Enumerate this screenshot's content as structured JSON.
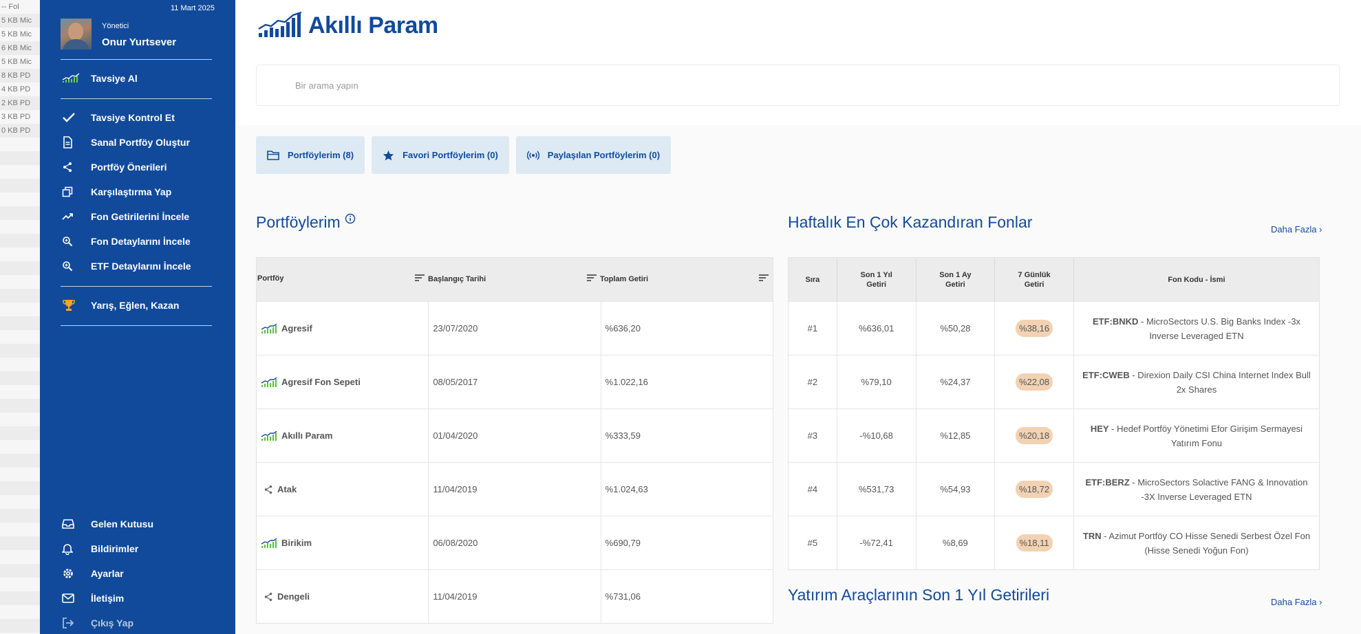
{
  "background_list": [
    {
      "size": "--",
      "type": "Fol"
    },
    {
      "size": "5 KB",
      "type": "Mic"
    },
    {
      "size": "5 KB",
      "type": "Mic"
    },
    {
      "size": "6 KB",
      "type": "Mic"
    },
    {
      "size": "5 KB",
      "type": "Mic"
    },
    {
      "size": "8 KB",
      "type": "PD"
    },
    {
      "size": "4 KB",
      "type": "PD"
    },
    {
      "size": "2 KB",
      "type": "PD"
    },
    {
      "size": "3 KB",
      "type": "PD"
    },
    {
      "size": "0 KB",
      "type": "PD"
    }
  ],
  "sidebar": {
    "date": "11 Mart 2025",
    "role": "Yönetici",
    "user_name": "Onur Yurtsever",
    "top_item": {
      "label": "Tavsiye Al",
      "icon": "chart-icon"
    },
    "items": [
      {
        "label": "Tavsiye Kontrol Et",
        "icon": "check-icon"
      },
      {
        "label": "Sanal Portföy Oluştur",
        "icon": "document-icon"
      },
      {
        "label": "Portföy Önerileri",
        "icon": "share-icon"
      },
      {
        "label": "Karşılaştırma Yap",
        "icon": "compare-icon"
      },
      {
        "label": "Fon Getirilerini İncele",
        "icon": "trend-icon"
      },
      {
        "label": "Fon Detaylarını İncele",
        "icon": "zoom-icon"
      },
      {
        "label": "ETF Detaylarını İncele",
        "icon": "zoom-icon"
      }
    ],
    "game_item": {
      "label": "Yarış, Eğlen, Kazan",
      "icon": "trophy-icon"
    },
    "bottom_items": [
      {
        "label": "Gelen Kutusu",
        "icon": "inbox-icon"
      },
      {
        "label": "Bildirimler",
        "icon": "bell-icon"
      },
      {
        "label": "Ayarlar",
        "icon": "gear-icon"
      },
      {
        "label": "İletişim",
        "icon": "mail-icon"
      },
      {
        "label": "Çıkış Yap",
        "icon": "logout-icon"
      }
    ]
  },
  "header": {
    "logo_text": "Akıllı Param",
    "search_placeholder": "Bir arama yapın"
  },
  "tabs": [
    {
      "label": "Portföylerim (8)",
      "icon": "folder-icon"
    },
    {
      "label": "Favori Portföylerim (0)",
      "icon": "star-icon"
    },
    {
      "label": "Paylaşılan Portföylerim (0)",
      "icon": "broadcast-icon"
    }
  ],
  "portfolios": {
    "title": "Portföylerim",
    "columns": [
      "Portföy",
      "Başlangıç Tarihi",
      "Toplam Getiri"
    ],
    "rows": [
      {
        "name": "Agresif",
        "start": "23/07/2020",
        "return": "%636,20",
        "icon": "chart-icon"
      },
      {
        "name": "Agresif Fon Sepeti",
        "start": "08/05/2017",
        "return": "%1.022,16",
        "icon": "chart-icon"
      },
      {
        "name": "Akıllı Param",
        "start": "01/04/2020",
        "return": "%333,59",
        "icon": "chart-icon"
      },
      {
        "name": "Atak",
        "start": "11/04/2019",
        "return": "%1.024,63",
        "icon": "share-icon"
      },
      {
        "name": "Birikim",
        "start": "06/08/2020",
        "return": "%690,79",
        "icon": "chart-icon"
      },
      {
        "name": "Dengeli",
        "start": "11/04/2019",
        "return": "%731,06",
        "icon": "share-icon"
      }
    ]
  },
  "weekly_funds": {
    "title": "Haftalık En Çok Kazandıran Fonlar",
    "more": "Daha Fazla ›",
    "columns": [
      "Sıra",
      "Son 1 Yıl\nGetiri",
      "Son 1 Ay\nGetiri",
      "7 Günlük\nGetiri",
      "Fon Kodu - İsmi"
    ],
    "rows": [
      {
        "rank": "#1",
        "y1": "%636,01",
        "m1": "%50,28",
        "d7": "%38,16",
        "code": "ETF:BNKD",
        "name": " - MicroSectors U.S. Big Banks Index -3x Inverse Leveraged ETN"
      },
      {
        "rank": "#2",
        "y1": "%79,10",
        "m1": "%24,37",
        "d7": "%22,08",
        "code": "ETF:CWEB",
        "name": " - Direxion Daily CSI China Internet Index Bull 2x Shares"
      },
      {
        "rank": "#3",
        "y1": "-%10,68",
        "m1": "%12,85",
        "d7": "%20,18",
        "code": "HEY",
        "name": " - Hedef Portföy Yönetimi Efor Girişim Sermayesi Yatırım Fonu"
      },
      {
        "rank": "#4",
        "y1": "%531,73",
        "m1": "%54,93",
        "d7": "%18,72",
        "code": "ETF:BERZ",
        "name": " - MicroSectors Solactive FANG & Innovation -3X Inverse Leveraged ETN"
      },
      {
        "rank": "#5",
        "y1": "-%72,41",
        "m1": "%8,69",
        "d7": "%18,11",
        "code": "TRN",
        "name": " - Azimut Portföy CO Hisse Senedi Serbest Özel Fon (Hisse Senedi Yoğun Fon)"
      }
    ]
  },
  "yearly": {
    "title": "Yatırım Araçlarının Son 1 Yıl Getirileri",
    "more": "Daha Fazla ›"
  },
  "colors": {
    "primary": "#114a9b",
    "tab_bg": "#ddeaf4",
    "badge": "#f2d2b3"
  }
}
